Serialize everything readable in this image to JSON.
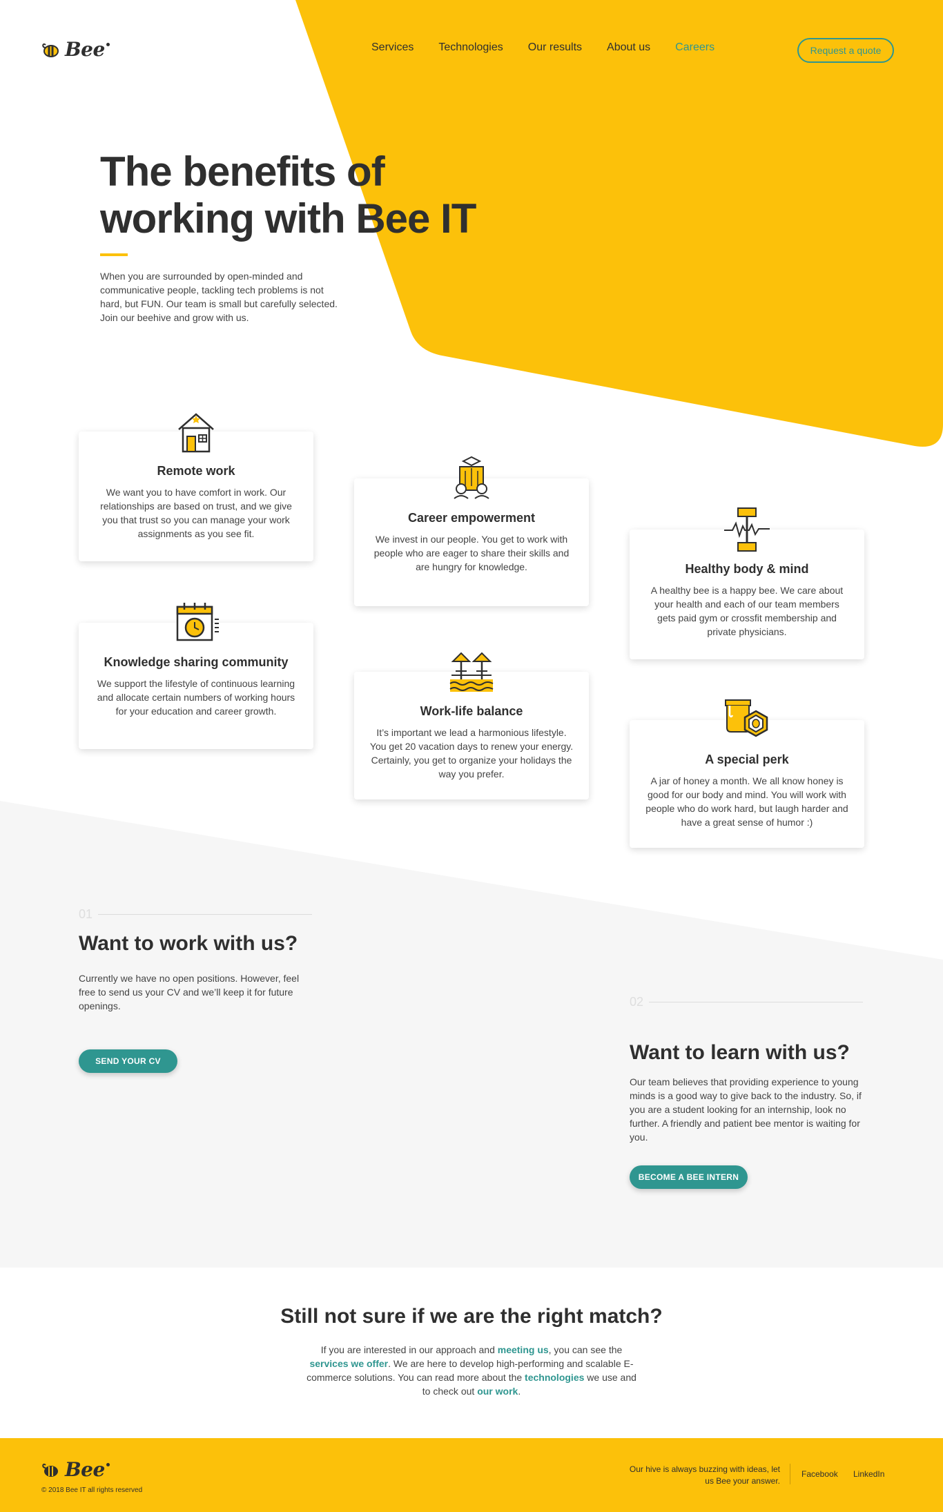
{
  "brand": {
    "name": "Bee",
    "accent": "#fcc10a",
    "teal": "#2f9690"
  },
  "nav": {
    "items": [
      {
        "label": "Services"
      },
      {
        "label": "Technologies"
      },
      {
        "label": "Our results"
      },
      {
        "label": "About us"
      },
      {
        "label": "Careers"
      }
    ],
    "quote_label": "Request a quote"
  },
  "hero": {
    "title": "The benefits of working with Bee IT",
    "text": "When you are surrounded by open-minded and communicative people, tackling tech problems is not hard, but FUN. Our team is small but carefully selected. Join our beehive and grow with us."
  },
  "benefits": [
    {
      "icon": "house-icon",
      "title": "Remote work",
      "text": "We want you to have comfort in work. Our relationships are based on trust, and we give you that trust so you can manage your work assignments as you see fit."
    },
    {
      "icon": "team-icon",
      "title": "Career empowerment",
      "text": "We invest in our people. You get to work with people who are eager to share their skills and are hungry for knowledge."
    },
    {
      "icon": "dumbbell-icon",
      "title": "Healthy body & mind",
      "text": "A healthy bee is a happy bee. We care about your health and each of our team members gets paid gym or crossfit membership and private physicians."
    },
    {
      "icon": "calendar-clock-icon",
      "title": "Knowledge sharing community",
      "text": "We support the lifestyle of continuous learning and allocate certain numbers of working hours for your education and career growth."
    },
    {
      "icon": "beach-icon",
      "title": "Work-life balance",
      "text": "It’s important we lead a harmonious lifestyle. You get 20 vacation days to renew your energy. Certainly, you get to organize your holidays the way you prefer."
    },
    {
      "icon": "honey-jar-icon",
      "title": "A special perk",
      "text": "A jar of honey a month. We all know honey is good for our body and mind. You will work with people who do work hard, but laugh harder and have a great sense of humor :)"
    }
  ],
  "work": {
    "num": "01",
    "title": "Want to work with us?",
    "text": "Currently we have no open positions. However, feel free to send us your CV and we’ll keep it for future openings.",
    "button": "SEND YOUR CV"
  },
  "learn": {
    "num": "02",
    "title": "Want to learn with us?",
    "text": "Our team believes that providing experience to young minds is a good way to give back to the industry. So, if you are a student looking for an internship, look no further. A friendly and patient bee mentor is waiting for you.",
    "button": "BECOME A BEE INTERN"
  },
  "match": {
    "title": "Still not sure if we are the right match?",
    "t1": "If you are interested in our approach and ",
    "l1": "meeting us",
    "t2": ", you can see the ",
    "l2": "services we offer",
    "t3": ". We are here to develop high-performing and scalable E-commerce solutions.  You can read more about the ",
    "l3": "technologies",
    "t4": " we use and to check out ",
    "l4": "our work",
    "t5": "."
  },
  "footer": {
    "copyright": "© 2018 Bee IT all rights reserved",
    "tagline": "Our hive is always buzzing with ideas, let us Bee your answer.",
    "links": [
      "Facebook",
      "LinkedIn"
    ]
  }
}
